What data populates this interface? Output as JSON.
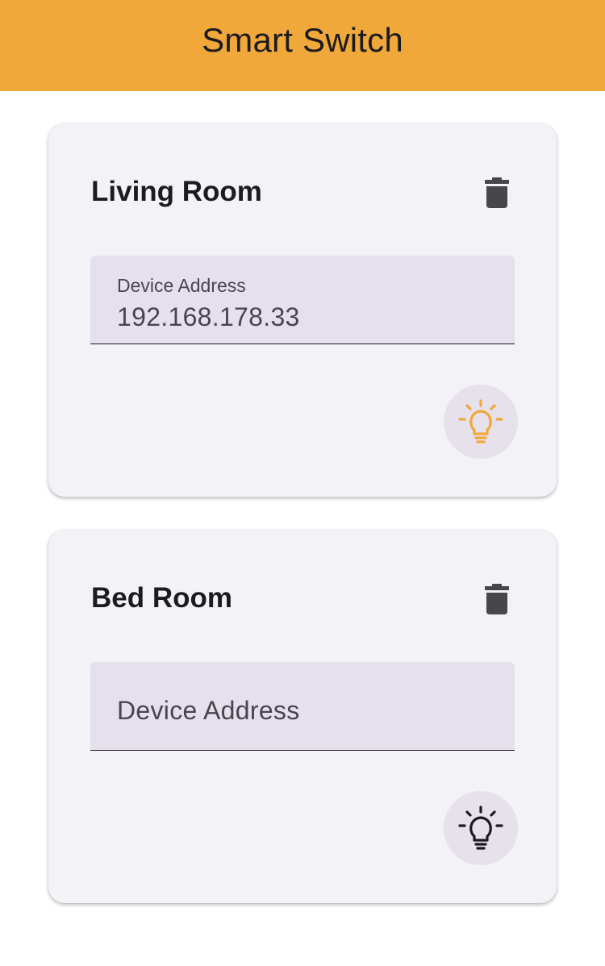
{
  "app_bar": {
    "title": "Smart Switch",
    "background_color": "#f1a83b"
  },
  "devices": [
    {
      "name": "Living Room",
      "address_label": "Device Address",
      "address_value": "192.168.178.33",
      "delete_icon": "trash-icon",
      "toggle_icon": "lightbulb-icon",
      "light_on": true,
      "icon_color": "#f1a83b"
    },
    {
      "name": "Bed Room",
      "address_label": "Device Address",
      "address_value": "",
      "delete_icon": "trash-icon",
      "toggle_icon": "lightbulb-icon",
      "light_on": false,
      "icon_color": "#1d1b20"
    }
  ]
}
